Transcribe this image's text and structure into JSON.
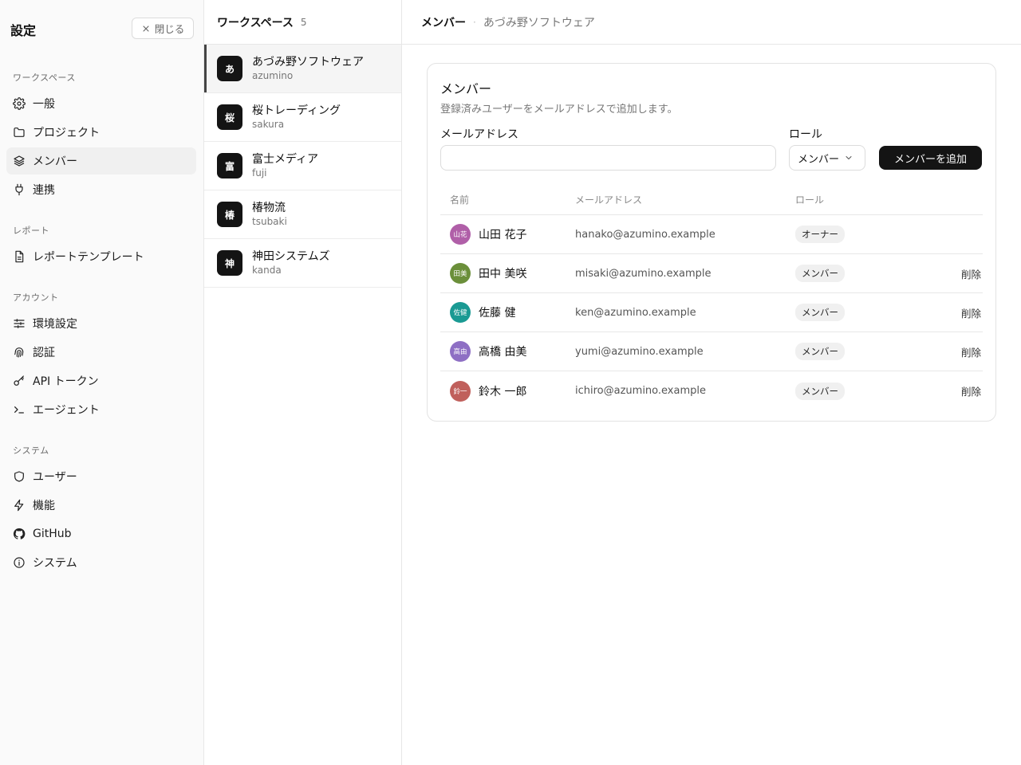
{
  "sidebar": {
    "title": "設定",
    "close_label": "閉じる",
    "sections": [
      {
        "label": "ワークスペース",
        "items": [
          {
            "label": "一般",
            "icon": "gear-icon"
          },
          {
            "label": "プロジェクト",
            "icon": "folder-icon"
          },
          {
            "label": "メンバー",
            "icon": "layers-icon",
            "active": true
          },
          {
            "label": "連携",
            "icon": "plug-icon"
          }
        ]
      },
      {
        "label": "レポート",
        "items": [
          {
            "label": "レポートテンプレート",
            "icon": "document-icon"
          }
        ]
      },
      {
        "label": "アカウント",
        "items": [
          {
            "label": "環境設定",
            "icon": "sliders-icon"
          },
          {
            "label": "認証",
            "icon": "fingerprint-icon"
          },
          {
            "label": "API トークン",
            "icon": "key-icon"
          },
          {
            "label": "エージェント",
            "icon": "terminal-icon"
          }
        ]
      },
      {
        "label": "システム",
        "items": [
          {
            "label": "ユーザー",
            "icon": "shield-icon"
          },
          {
            "label": "機能",
            "icon": "zap-icon"
          },
          {
            "label": "GitHub",
            "icon": "github-icon"
          },
          {
            "label": "システム",
            "icon": "info-icon"
          }
        ]
      }
    ]
  },
  "workspaces": {
    "title": "ワークスペース",
    "count": "5",
    "items": [
      {
        "avatar": "あ",
        "name": "あづみ野ソフトウェア",
        "slug": "azumino",
        "active": true
      },
      {
        "avatar": "桜",
        "name": "桜トレーディング",
        "slug": "sakura"
      },
      {
        "avatar": "富",
        "name": "富士メディア",
        "slug": "fuji"
      },
      {
        "avatar": "椿",
        "name": "椿物流",
        "slug": "tsubaki"
      },
      {
        "avatar": "神",
        "name": "神田システムズ",
        "slug": "kanda"
      }
    ]
  },
  "header": {
    "current": "メンバー",
    "separator": "·",
    "workspace": "あづみ野ソフトウェア"
  },
  "members": {
    "title": "メンバー",
    "subtitle": "登録済みユーザーをメールアドレスで追加します。",
    "email_label": "メールアドレス",
    "email_value": "",
    "role_label": "ロール",
    "role_value": "メンバー",
    "add_label": "メンバーを追加",
    "columns": {
      "name": "名前",
      "email": "メールアドレス",
      "role": "ロール"
    },
    "rows": [
      {
        "initials": "山花",
        "color": "#b05fa8",
        "name": "山田 花子",
        "email": "hanako@azumino.example",
        "role": "オーナー",
        "action": ""
      },
      {
        "initials": "田美",
        "color": "#6b8f3a",
        "name": "田中 美咲",
        "email": "misaki@azumino.example",
        "role": "メンバー",
        "action": "削除"
      },
      {
        "initials": "佐健",
        "color": "#1a9a93",
        "name": "佐藤 健",
        "email": "ken@azumino.example",
        "role": "メンバー",
        "action": "削除"
      },
      {
        "initials": "高由",
        "color": "#8e6fc4",
        "name": "高橋 由美",
        "email": "yumi@azumino.example",
        "role": "メンバー",
        "action": "削除"
      },
      {
        "initials": "鈴一",
        "color": "#c0605c",
        "name": "鈴木 一郎",
        "email": "ichiro@azumino.example",
        "role": "メンバー",
        "action": "削除"
      }
    ]
  }
}
